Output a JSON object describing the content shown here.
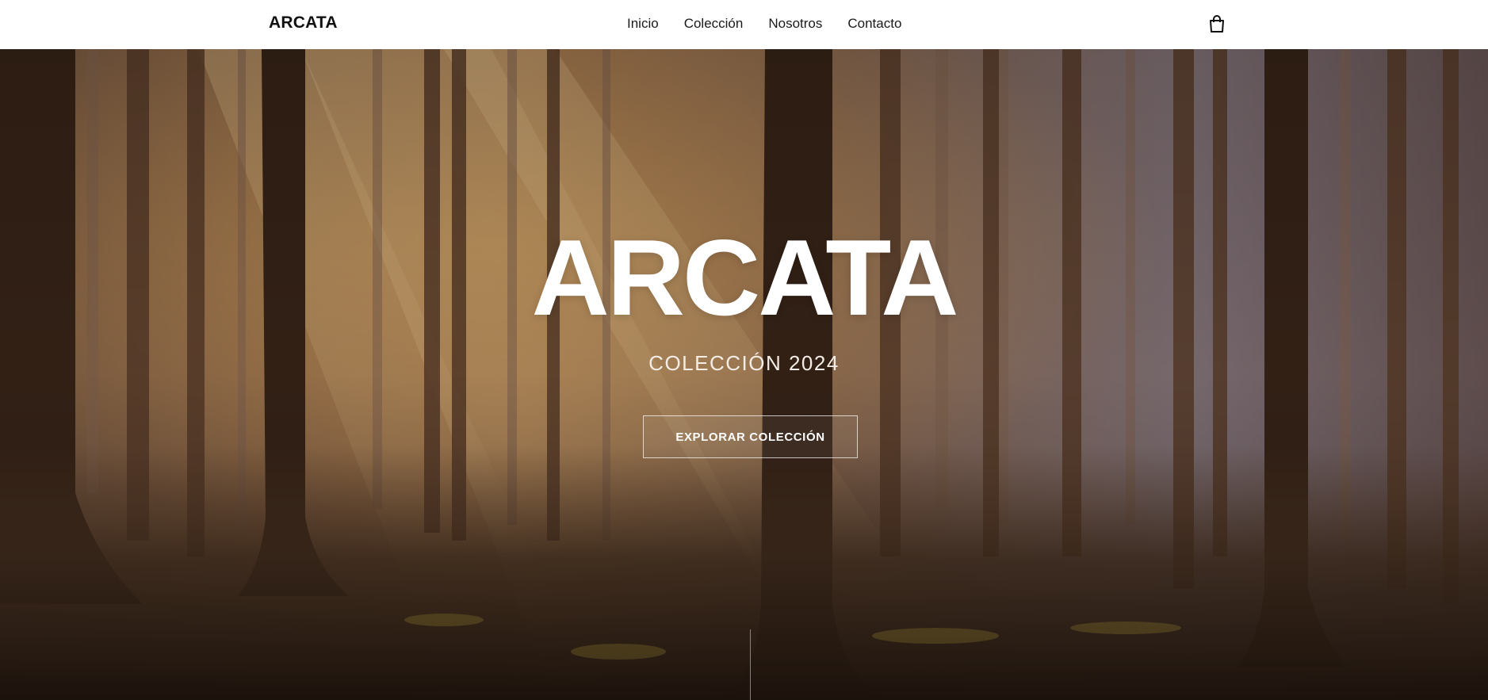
{
  "header": {
    "brand": "ARCATA",
    "nav": [
      {
        "label": "Inicio"
      },
      {
        "label": "Colección"
      },
      {
        "label": "Nosotros"
      },
      {
        "label": "Contacto"
      }
    ],
    "cart_icon": "shopping-bag-icon"
  },
  "hero": {
    "background": "forest-sunbeams-photo",
    "title": "ARCATA",
    "subtitle": "COLECCIÓN 2024",
    "cta_label": "EXPLORAR COLECCIÓN"
  },
  "colors": {
    "header_bg": "#ffffff",
    "header_text": "#111111",
    "hero_text": "#ffffff"
  }
}
